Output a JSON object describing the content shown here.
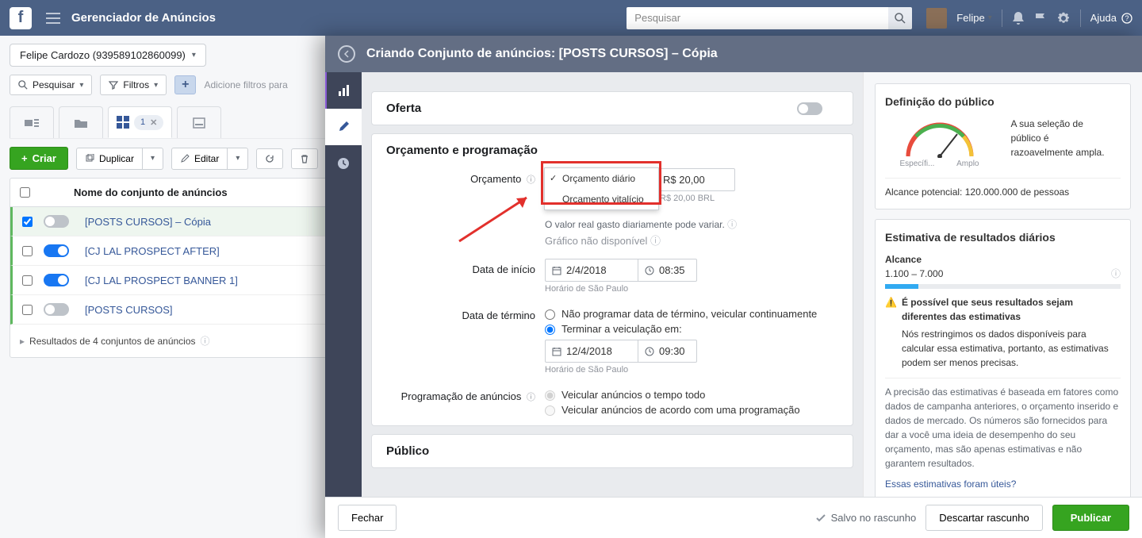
{
  "topbar": {
    "app_title": "Gerenciador de Anúncios",
    "search_placeholder": "Pesquisar",
    "user_name": "Felipe",
    "help_label": "Ajuda"
  },
  "account": {
    "label": "Felipe Cardozo (939589102860099)"
  },
  "filters": {
    "search_label": "Pesquisar",
    "filters_label": "Filtros",
    "hint": "Adicione filtros para"
  },
  "tabs": {
    "active_count": "1"
  },
  "toolbar": {
    "create_label": "Criar",
    "duplicate_label": "Duplicar",
    "edit_label": "Editar"
  },
  "table": {
    "col_name": "Nome do conjunto de anúncios",
    "rows": [
      {
        "name": "[POSTS CURSOS] – Cópia",
        "enabled": false,
        "checked": true
      },
      {
        "name": "[CJ LAL PROSPECT AFTER]",
        "enabled": true,
        "checked": false
      },
      {
        "name": "[CJ LAL PROSPECT BANNER 1]",
        "enabled": true,
        "checked": false
      },
      {
        "name": "[POSTS CURSOS]",
        "enabled": false,
        "checked": false
      }
    ],
    "footer": "Resultados de 4 conjuntos de anúncios"
  },
  "editor": {
    "header_title": "Criando Conjunto de anúncios: [POSTS CURSOS] – Cópia",
    "offer_title": "Oferta",
    "section_title": "Orçamento e programação",
    "budget_label": "Orçamento",
    "budget_option_daily": "Orçamento diário",
    "budget_option_lifetime": "Orçamento vitalício",
    "budget_value": "R$ 20,00",
    "budget_sub": "R$ 20,00 BRL",
    "budget_note": "O valor real gasto diariamente pode variar.",
    "chart_na": "Gráfico não disponível",
    "start_label": "Data de início",
    "start_date": "2/4/2018",
    "start_time": "08:35",
    "tz_note": "Horário de São Paulo",
    "end_label": "Data de término",
    "end_no_schedule": "Não programar data de término, veicular continuamente",
    "end_schedule_on": "Terminar a veiculação em:",
    "end_date": "12/4/2018",
    "end_time": "09:30",
    "adsched_label": "Programação de anúncios",
    "adsched_all": "Veicular anúncios o tempo todo",
    "adsched_plan": "Veicular anúncios de acordo com uma programação",
    "audience_title": "Público"
  },
  "rightpanel": {
    "def_title": "Definição do público",
    "gauge_left": "Específi...",
    "gauge_right": "Amplo",
    "def_desc": "A sua seleção de público é razoavelmente ampla.",
    "reach_line": "Alcance potencial: 120.000.000 de pessoas",
    "est_title": "Estimativa de resultados diários",
    "reach_label": "Alcance",
    "reach_range": "1.100 – 7.000",
    "warn_text": "É possível que seus resultados sejam diferentes das estimativas",
    "warn_detail": "Nós restringimos os dados disponíveis para calcular essa estimativa, portanto, as estimativas podem ser menos precisas.",
    "disclaimer": "A precisão das estimativas é baseada em fatores como dados de campanha anteriores, o orçamento inserido e dados de mercado. Os números são fornecidos para dar a você uma ideia de desempenho do seu orçamento, mas são apenas estimativas e não garantem resultados.",
    "feedback_link": "Essas estimativas foram úteis?"
  },
  "footer": {
    "close_label": "Fechar",
    "saved_label": "Salvo no rascunho",
    "discard_label": "Descartar rascunho",
    "publish_label": "Publicar"
  }
}
